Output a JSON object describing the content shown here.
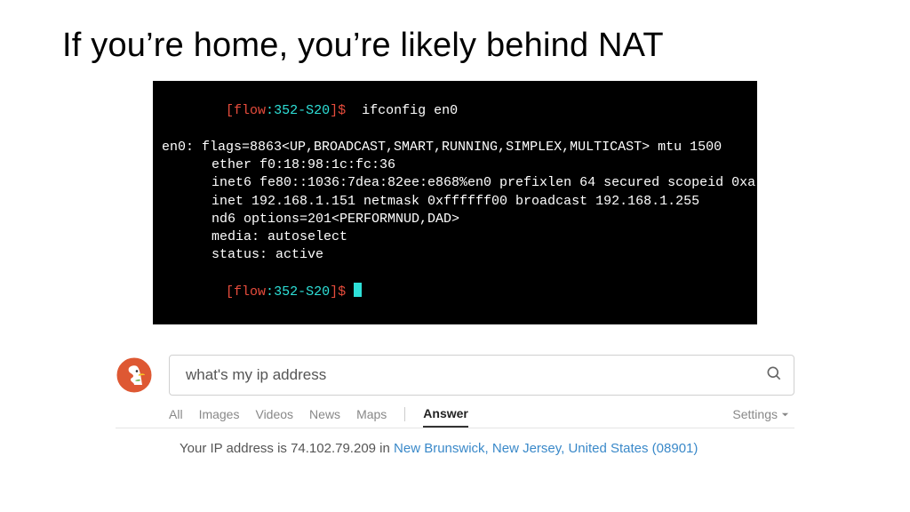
{
  "title": "If you’re home, you’re likely behind NAT",
  "terminal": {
    "prompt_open": "[",
    "prompt_host": "flow",
    "prompt_sep": ":",
    "prompt_cwd": "352-S20",
    "prompt_close": "]$ ",
    "cmd": " ifconfig en0",
    "l1": "en0: flags=8863<UP,BROADCAST,SMART,RUNNING,SIMPLEX,MULTICAST> mtu 1500",
    "l2": "ether f0:18:98:1c:fc:36",
    "l3": "inet6 fe80::1036:7dea:82ee:e868%en0 prefixlen 64 secured scopeid 0xa",
    "l4": "inet 192.168.1.151 netmask 0xffffff00 broadcast 192.168.1.255",
    "l5": "nd6 options=201<PERFORMNUD,DAD>",
    "l6": "media: autoselect",
    "l7": "status: active"
  },
  "search": {
    "query": "what's my ip address",
    "tabs": {
      "all": "All",
      "images": "Images",
      "videos": "Videos",
      "news": "News",
      "maps": "Maps",
      "answer": "Answer"
    },
    "settings_label": "Settings",
    "answer_prefix": "Your IP address is ",
    "answer_ip": "74.102.79.209",
    "answer_mid": " in ",
    "answer_location": "New Brunswick, New Jersey, United States (08901)"
  }
}
